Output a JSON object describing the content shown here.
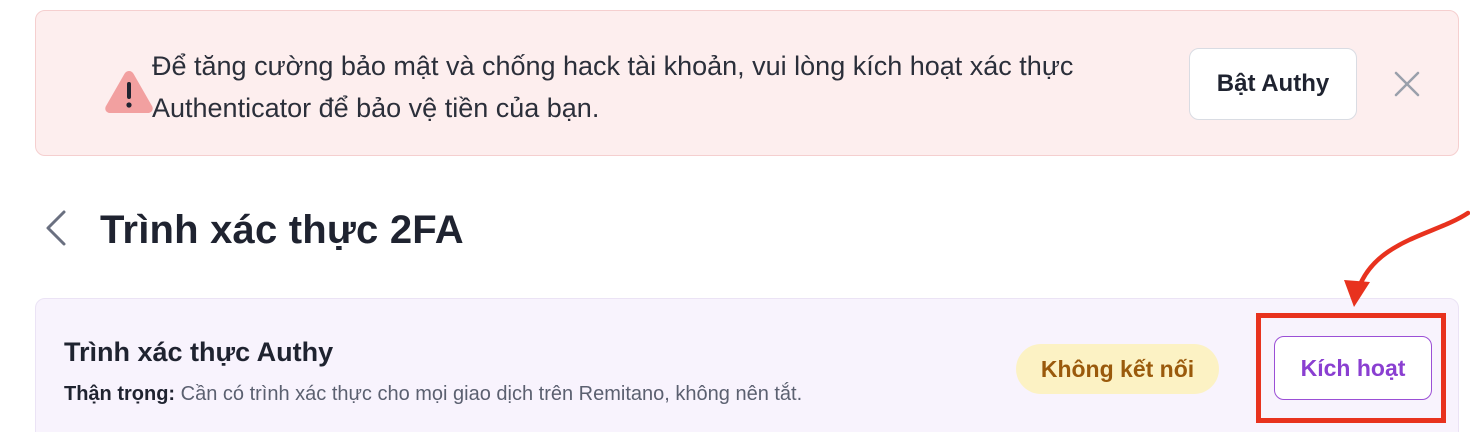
{
  "alert": {
    "message_line1": "Để tăng cường bảo mật và chống hack tài khoản, vui lòng kích hoạt xác thực",
    "message_line2": "Authenticator để bảo vệ tiền của bạn.",
    "button_label": "Bật Authy",
    "icon": "warning-triangle-icon",
    "close_icon": "close-icon",
    "color_bg": "#fdeeee",
    "color_icon": "#f2a0a0"
  },
  "header": {
    "back_icon": "chevron-left-icon",
    "title": "Trình xác thực 2FA"
  },
  "card": {
    "title": "Trình xác thực Authy",
    "note_label": "Thận trọng:",
    "note_text": "Cần có trình xác thực cho mọi giao dịch trên Remitano, không nên tắt.",
    "status": "Không kết nối",
    "action_label": "Kích hoạt",
    "color_accent": "#8a3fd1",
    "color_status_bg": "#fcf2c4"
  },
  "annotation": {
    "color": "#e8321e"
  }
}
